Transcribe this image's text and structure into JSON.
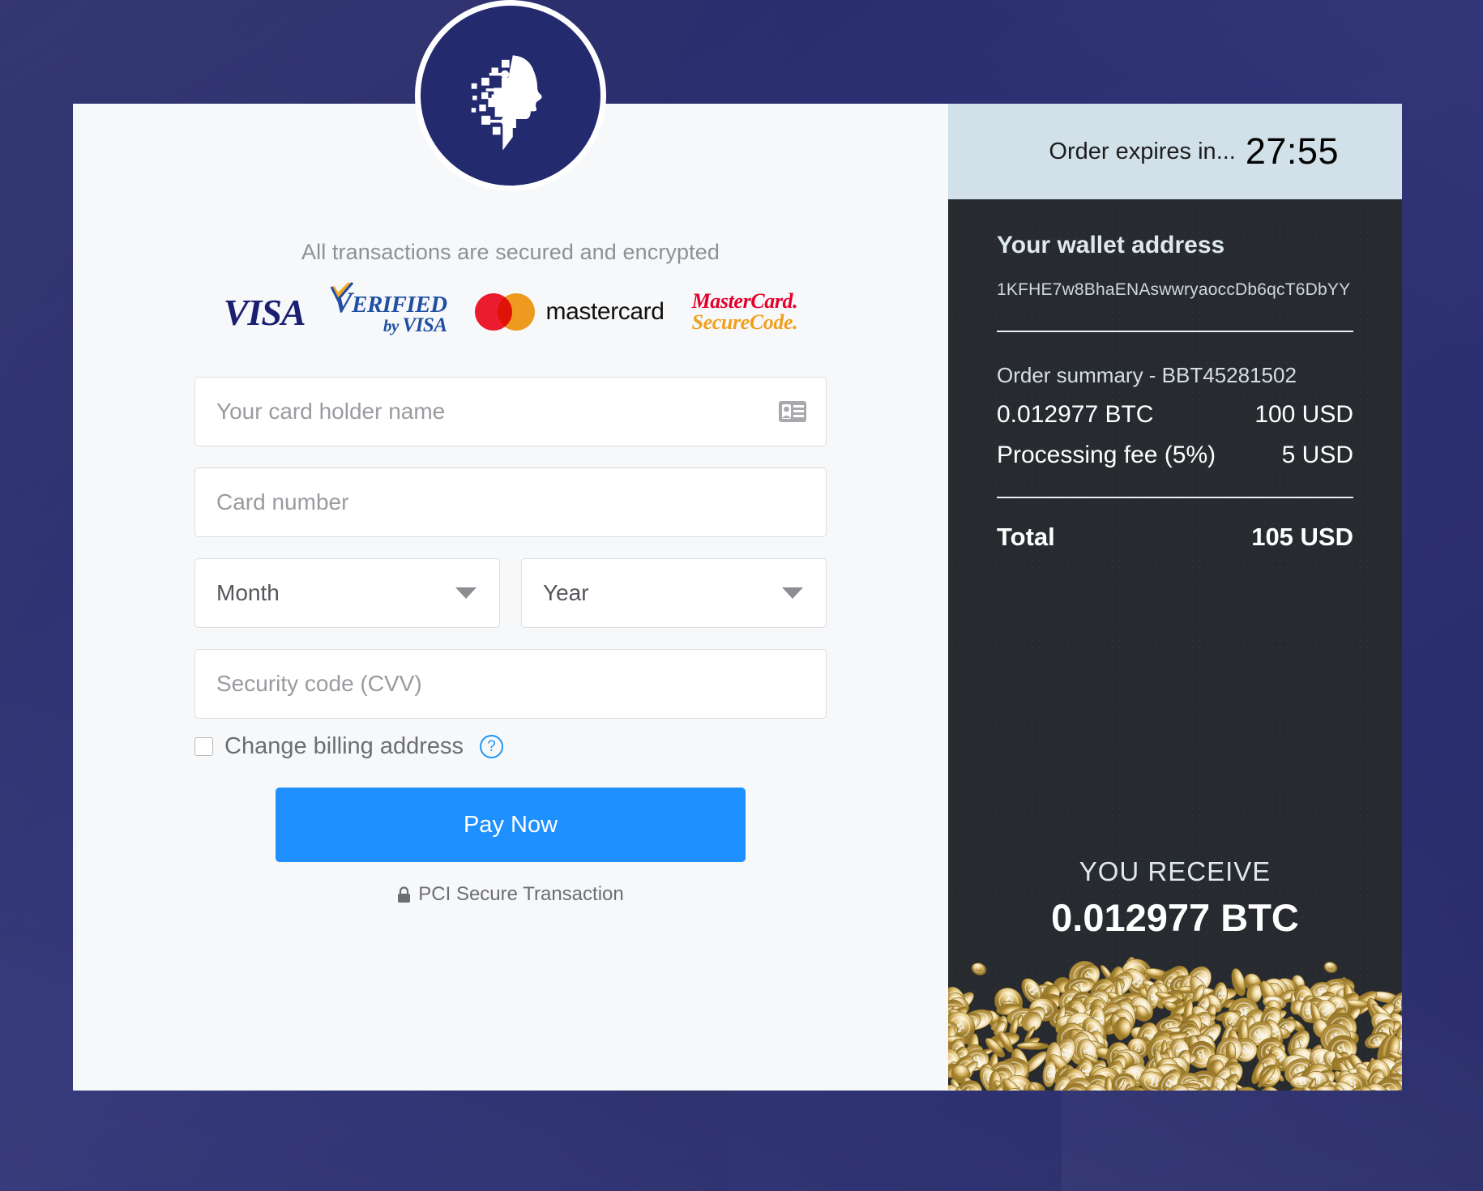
{
  "brand": {
    "logo_icon": "digital-face-profile-logo",
    "logo_bg": "#232a6e"
  },
  "left": {
    "secure_note": "All transactions are secured and encrypted",
    "brands": [
      {
        "name": "visa",
        "text": "VISA"
      },
      {
        "name": "verified-by-visa",
        "top": "ERIFIED",
        "top_cap": "V",
        "bottom_by": "by ",
        "bottom": "VISA"
      },
      {
        "name": "mastercard",
        "text": "mastercard"
      },
      {
        "name": "mastercard-securecode",
        "line1": "MasterCard.",
        "line2": "SecureCode."
      }
    ],
    "fields": {
      "card_holder": {
        "placeholder": "Your card holder name",
        "value": "",
        "icon": "contact-card-icon"
      },
      "card_number": {
        "placeholder": "Card number",
        "value": ""
      },
      "month": {
        "placeholder": "Month",
        "value": ""
      },
      "year": {
        "placeholder": "Year",
        "value": ""
      },
      "cvv": {
        "placeholder": "Security code (CVV)",
        "value": ""
      }
    },
    "billing": {
      "label": "Change billing address",
      "checked": false,
      "help_icon": "?"
    },
    "pay_button": "Pay Now",
    "pci_note": "PCI Secure Transaction",
    "accent_color": "#1e90ff"
  },
  "right": {
    "expiry_label": "Order expires in...",
    "expiry_time": "27:55",
    "expiry_bar_color": "#d1e0e9",
    "wallet_title": "Your wallet address",
    "wallet_address": "1KFHE7w8BhaENAswwryaoccDb6qcT6DbYY",
    "summary_title": "Order summary - BBT45281502",
    "lines": [
      {
        "label": "0.012977 BTC",
        "value": "100 USD"
      },
      {
        "label": "Processing fee (5%)",
        "value": "5 USD"
      }
    ],
    "total": {
      "label": "Total",
      "value": "105 USD"
    },
    "receive_label": "YOU RECEIVE",
    "receive_amount": "0.012977 BTC",
    "panel_color": "#272b30"
  },
  "page": {
    "background_color": "#2a2d6d"
  }
}
